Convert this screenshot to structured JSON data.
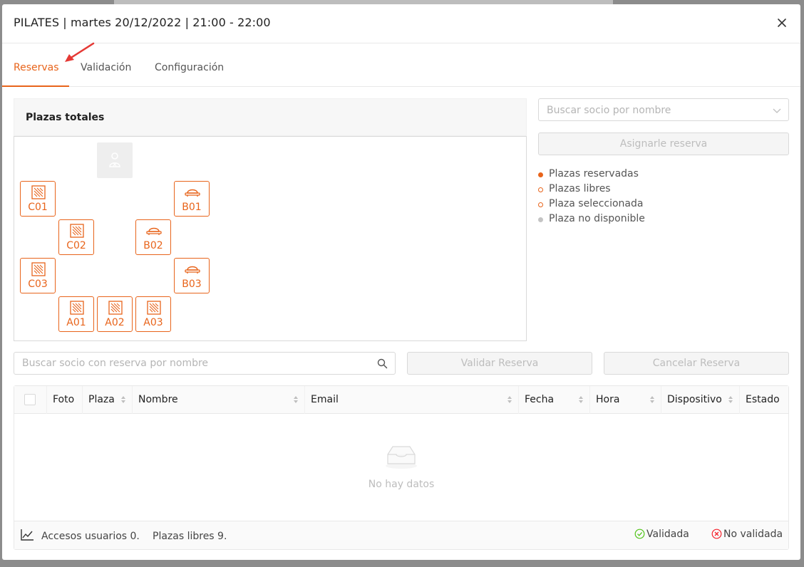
{
  "modal": {
    "title": "PILATES | martes 20/12/2022 | 21:00 - 22:00"
  },
  "tabs": [
    {
      "label": "Reservas"
    },
    {
      "label": "Validación"
    },
    {
      "label": "Configuración"
    }
  ],
  "plazas": {
    "title": "Plazas totales",
    "seats": [
      {
        "label": "C01",
        "icon": "mat-icon"
      },
      {
        "label": "C02",
        "icon": "mat-icon"
      },
      {
        "label": "C03",
        "icon": "mat-icon"
      },
      {
        "label": "B01",
        "icon": "reformer-icon"
      },
      {
        "label": "B02",
        "icon": "reformer-icon"
      },
      {
        "label": "B03",
        "icon": "reformer-icon"
      },
      {
        "label": "A01",
        "icon": "mat-icon"
      },
      {
        "label": "A02",
        "icon": "mat-icon"
      },
      {
        "label": "A03",
        "icon": "mat-icon"
      }
    ]
  },
  "assign": {
    "select_placeholder": "Buscar socio por nombre",
    "button_label": "Asignarle reserva"
  },
  "legend": [
    {
      "label": "Plazas reservadas",
      "color": "#e8641b",
      "style": "filled"
    },
    {
      "label": "Plazas libres",
      "color": "#e8641b",
      "style": "outline"
    },
    {
      "label": "Plaza seleccionada",
      "color": "#e8641b",
      "style": "outline"
    },
    {
      "label": "Plaza no disponible",
      "color": "#c4c4c4",
      "style": "filled"
    }
  ],
  "reservations": {
    "search_placeholder": "Buscar socio con reserva por nombre",
    "validate_label": "Validar Reserva",
    "cancel_label": "Cancelar Reserva"
  },
  "table": {
    "columns": [
      "Foto",
      "Plaza",
      "Nombre",
      "Email",
      "Fecha",
      "Hora",
      "Dispositivo",
      "Estado"
    ],
    "empty_text": "No hay datos",
    "footer": {
      "accesos": "Accesos usuarios 0.",
      "libres": "Plazas libres 9.",
      "validada": "Validada",
      "no_validada": "No validada"
    }
  },
  "colors": {
    "accent": "#e8641b",
    "valid": "#52c41a",
    "invalid": "#f5222d"
  }
}
